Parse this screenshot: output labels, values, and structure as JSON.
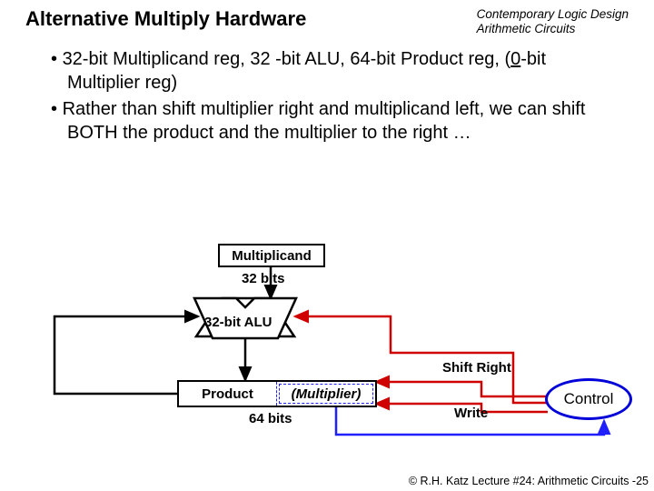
{
  "header": {
    "title": "Alternative Multiply Hardware",
    "course_line1": "Contemporary Logic Design",
    "course_line2": "Arithmetic Circuits"
  },
  "bullets": {
    "b1_pre": "32-bit Multiplicand reg, 32 -bit ALU, 64-bit Product reg,  (",
    "b1_u": "0",
    "b1_post": "-bit Multiplier reg)",
    "b2": "Rather than shift multiplier right and multiplicand left, we can shift BOTH the product and the multiplier to the right …"
  },
  "diagram": {
    "multiplicand": "Multiplicand",
    "bits32": "32 bits",
    "alu": "32-bit ALU",
    "product": "Product",
    "multiplier": "(Multiplier)",
    "bits64": "64 bits",
    "shift_right": "Shift Right",
    "write": "Write",
    "control": "Control"
  },
  "footer": "© R.H. Katz   Lecture #24: Arithmetic Circuits -25"
}
